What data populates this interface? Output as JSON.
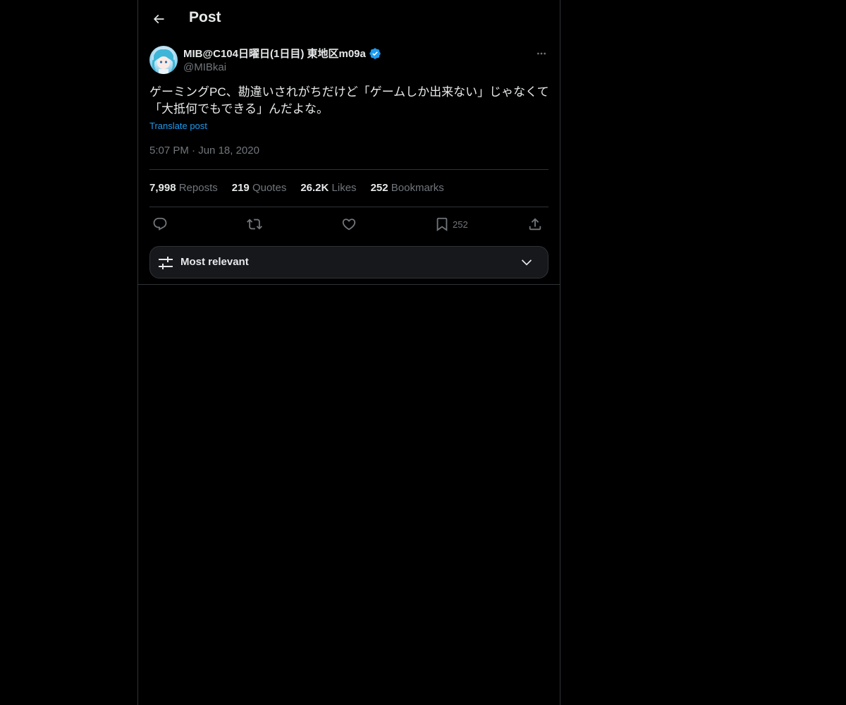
{
  "header": {
    "title": "Post"
  },
  "author": {
    "display_name": "MIB@C104日曜日(1日目) 東地区m09a",
    "handle": "@MIBkai",
    "verified": true
  },
  "post": {
    "text": "ゲーミングPC、勘違いされがちだけど「ゲームしか出来ない」じゃなくて「大抵何でもできる」んだよな。",
    "translate_label": "Translate post",
    "time": "5:07 PM",
    "separator": "·",
    "date": "Jun 18, 2020"
  },
  "stats": [
    {
      "value": "7,998",
      "label": "Reposts"
    },
    {
      "value": "219",
      "label": "Quotes"
    },
    {
      "value": "26.2K",
      "label": "Likes"
    },
    {
      "value": "252",
      "label": "Bookmarks"
    }
  ],
  "actions": {
    "bookmark_count": "252"
  },
  "sort": {
    "label": "Most relevant"
  },
  "colors": {
    "background": "#000000",
    "text": "#e7e9ea",
    "secondary": "#71767b",
    "accent": "#1d9bf0",
    "border": "#2f3336"
  }
}
